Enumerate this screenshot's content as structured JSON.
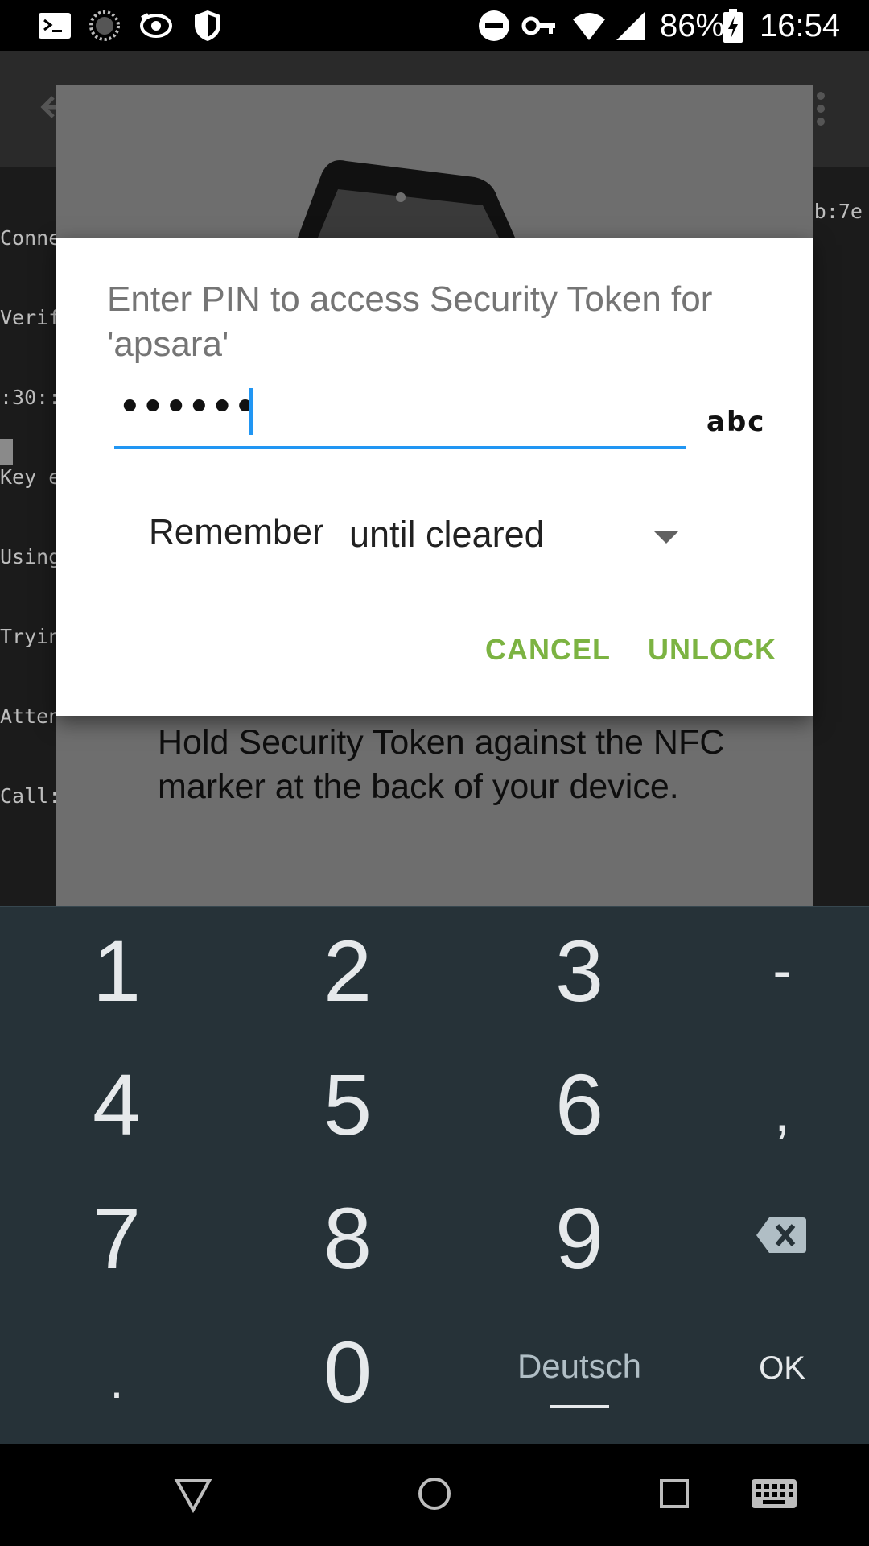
{
  "status_bar": {
    "battery": "86%",
    "time": "16:54",
    "left_icons": [
      "terminal-icon",
      "loading-icon",
      "sync-icon",
      "shield-icon"
    ],
    "right_icons": [
      "do-not-disturb-icon",
      "key-icon",
      "wifi-icon",
      "signal-icon",
      "battery-charging-icon"
    ]
  },
  "background": {
    "terminal_lines": [
      "Conne",
      "Verif",
      ":30::",
      "Key e",
      "Using",
      "Tryin",
      "Atten",
      "Call:"
    ],
    "terminal_right_fragment": "b:7e",
    "nfc_instruction": "Hold Security Token against the NFC marker at the back of your device."
  },
  "dialog": {
    "title": "Enter PIN to access Security Token for 'apsara'",
    "pin_masked": "••••••",
    "keyboard_toggle": "abc",
    "remember_label": "Remember",
    "remember_value": "until cleared",
    "cancel_label": "CANCEL",
    "unlock_label": "UNLOCK",
    "accent_color": "#7cb342",
    "field_color": "#2196f3"
  },
  "keyboard": {
    "keys": [
      [
        "1",
        "2",
        "3",
        "-"
      ],
      [
        "4",
        "5",
        "6",
        ","
      ],
      [
        "7",
        "8",
        "9",
        "backspace"
      ],
      [
        ".",
        "0",
        "Deutsch",
        "OK"
      ]
    ],
    "language": "Deutsch",
    "ok_label": "OK",
    "background_color": "#263238"
  },
  "nav_bar": {
    "buttons": [
      "back-icon",
      "home-icon",
      "recents-icon",
      "keyboard-switch-icon"
    ]
  }
}
